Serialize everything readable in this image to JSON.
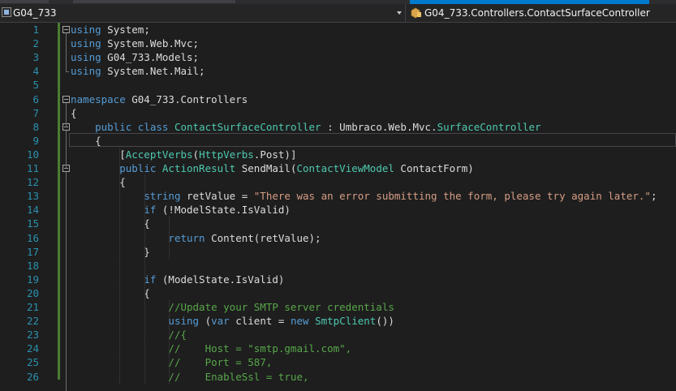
{
  "nav": {
    "project": "G04_733",
    "class_path": "G04_733.Controllers.ContactSurfaceController"
  },
  "editor": {
    "lines": [
      {
        "n": "1",
        "tokens": [
          {
            "t": "using",
            "c": "kw"
          },
          {
            "t": " System;"
          }
        ]
      },
      {
        "n": "2",
        "tokens": [
          {
            "t": "using",
            "c": "kw"
          },
          {
            "t": " System.Web.Mvc;"
          }
        ]
      },
      {
        "n": "3",
        "tokens": [
          {
            "t": "using",
            "c": "kw"
          },
          {
            "t": " G04_733.Models;"
          }
        ]
      },
      {
        "n": "4",
        "tokens": [
          {
            "t": "using",
            "c": "kw"
          },
          {
            "t": " System.Net.Mail;"
          }
        ]
      },
      {
        "n": "5",
        "tokens": []
      },
      {
        "n": "6",
        "tokens": [
          {
            "t": "namespace",
            "c": "kw"
          },
          {
            "t": " G04_733.Controllers"
          }
        ]
      },
      {
        "n": "7",
        "tokens": [
          {
            "t": "{"
          }
        ]
      },
      {
        "n": "8",
        "tokens": [
          {
            "t": "    "
          },
          {
            "t": "public",
            "c": "kw"
          },
          {
            "t": " "
          },
          {
            "t": "class",
            "c": "kw"
          },
          {
            "t": " "
          },
          {
            "t": "ContactSurfaceController",
            "c": "ty"
          },
          {
            "t": " : Umbraco.Web.Mvc."
          },
          {
            "t": "SurfaceController",
            "c": "ty"
          }
        ]
      },
      {
        "n": "9",
        "tokens": [
          {
            "t": "    {"
          }
        ]
      },
      {
        "n": "10",
        "tokens": [
          {
            "t": "        ["
          },
          {
            "t": "AcceptVerbs",
            "c": "ty"
          },
          {
            "t": "("
          },
          {
            "t": "HttpVerbs",
            "c": "ty"
          },
          {
            "t": ".Post)]"
          }
        ]
      },
      {
        "n": "11",
        "tokens": [
          {
            "t": "        "
          },
          {
            "t": "public",
            "c": "kw"
          },
          {
            "t": " "
          },
          {
            "t": "ActionResult",
            "c": "ty"
          },
          {
            "t": " SendMail("
          },
          {
            "t": "ContactViewModel",
            "c": "ty"
          },
          {
            "t": " ContactForm)"
          }
        ]
      },
      {
        "n": "12",
        "tokens": [
          {
            "t": "        {"
          }
        ]
      },
      {
        "n": "13",
        "tokens": [
          {
            "t": "            "
          },
          {
            "t": "string",
            "c": "kw"
          },
          {
            "t": " retValue = "
          },
          {
            "t": "\"There was an error submitting the form, please try again later.\"",
            "c": "st"
          },
          {
            "t": ";"
          }
        ]
      },
      {
        "n": "14",
        "tokens": [
          {
            "t": "            "
          },
          {
            "t": "if",
            "c": "kw"
          },
          {
            "t": " (!ModelState.IsValid)"
          }
        ]
      },
      {
        "n": "15",
        "tokens": [
          {
            "t": "            {"
          }
        ]
      },
      {
        "n": "16",
        "tokens": [
          {
            "t": "                "
          },
          {
            "t": "return",
            "c": "kw"
          },
          {
            "t": " Content(retValue);"
          }
        ]
      },
      {
        "n": "17",
        "tokens": [
          {
            "t": "            }"
          }
        ]
      },
      {
        "n": "18",
        "tokens": []
      },
      {
        "n": "19",
        "tokens": [
          {
            "t": "            "
          },
          {
            "t": "if",
            "c": "kw"
          },
          {
            "t": " (ModelState.IsValid)"
          }
        ]
      },
      {
        "n": "20",
        "tokens": [
          {
            "t": "            {"
          }
        ]
      },
      {
        "n": "21",
        "tokens": [
          {
            "t": "                "
          },
          {
            "t": "//Update your SMTP server credentials",
            "c": "cm"
          }
        ]
      },
      {
        "n": "22",
        "tokens": [
          {
            "t": "                "
          },
          {
            "t": "using",
            "c": "kw"
          },
          {
            "t": " ("
          },
          {
            "t": "var",
            "c": "kw"
          },
          {
            "t": " client = "
          },
          {
            "t": "new",
            "c": "kw"
          },
          {
            "t": " "
          },
          {
            "t": "SmtpClient",
            "c": "ty"
          },
          {
            "t": "())"
          }
        ]
      },
      {
        "n": "23",
        "tokens": [
          {
            "t": "                "
          },
          {
            "t": "//{",
            "c": "cm"
          }
        ]
      },
      {
        "n": "24",
        "tokens": [
          {
            "t": "                "
          },
          {
            "t": "//    Host = \"smtp.gmail.com\",",
            "c": "cm"
          }
        ]
      },
      {
        "n": "25",
        "tokens": [
          {
            "t": "                "
          },
          {
            "t": "//    Port = 587,",
            "c": "cm"
          }
        ]
      },
      {
        "n": "26",
        "tokens": [
          {
            "t": "                "
          },
          {
            "t": "//    EnableSsl = true,",
            "c": "cm"
          }
        ]
      }
    ]
  }
}
